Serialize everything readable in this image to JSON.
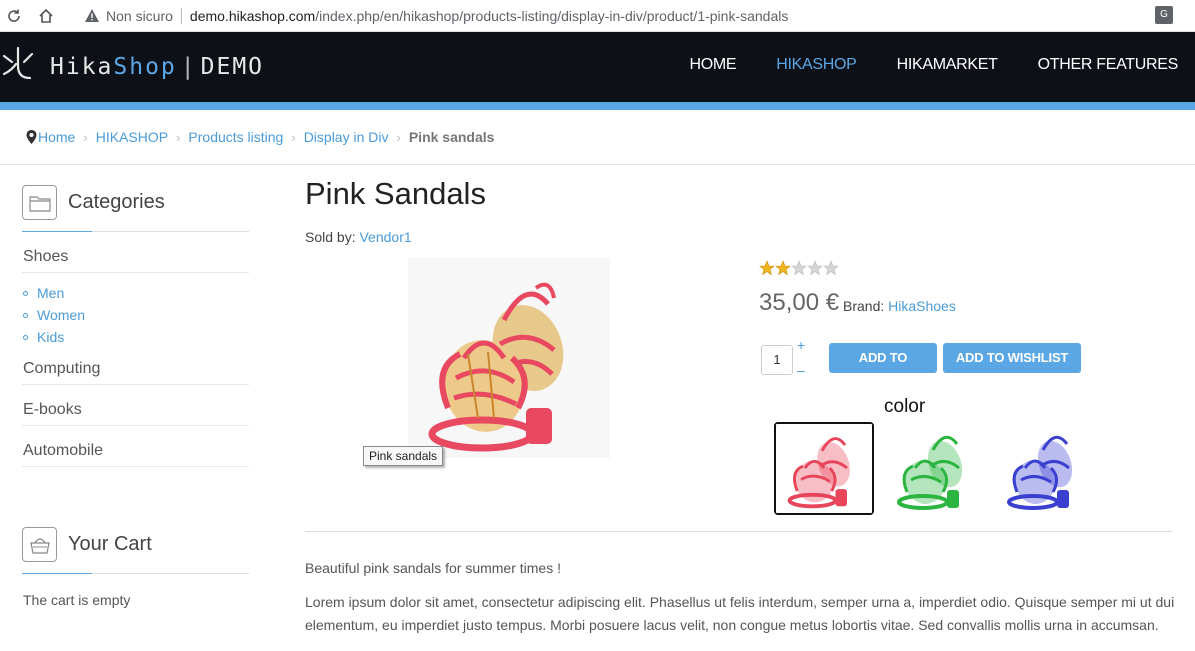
{
  "browser": {
    "security_label": "Non sicuro",
    "url_host": "demo.hikashop.com",
    "url_path": "/index.php/en/hikashop/products-listing/display-in-div/product/1-pink-sandals"
  },
  "header": {
    "logo_part1": "Hika",
    "logo_part2": "Shop",
    "logo_divider": "|",
    "logo_part3": "DEMO",
    "nav": [
      "HOME",
      "HIKASHOP",
      "HIKAMARKET",
      "OTHER FEATURES"
    ],
    "accent_color": "#5ba7e6"
  },
  "breadcrumb": {
    "items": [
      "Home",
      "HIKASHOP",
      "Products listing",
      "Display in Div"
    ],
    "current": "Pink sandals"
  },
  "sidebar": {
    "categories_title": "Categories",
    "categories": [
      "Shoes",
      "Computing",
      "E-books",
      "Automobile"
    ],
    "subcategories": [
      "Men",
      "Women",
      "Kids"
    ],
    "cart_title": "Your Cart",
    "cart_status": "The cart is empty"
  },
  "product": {
    "title": "Pink Sandals",
    "sold_by_label": "Sold by:",
    "vendor": "Vendor1",
    "image_tooltip": "Pink sandals",
    "rating": 2,
    "rating_max": 5,
    "price": "35,00 €",
    "brand_label": "Brand:",
    "brand": "HikaShoes",
    "quantity": "1",
    "qty_plus": "+",
    "qty_minus": "–",
    "add_to_cart": "ADD TO CART",
    "add_to_wishlist": "ADD TO WISHLIST",
    "color_label": "color",
    "colors": [
      {
        "name": "pink",
        "hex": "#e8445a"
      },
      {
        "name": "green",
        "hex": "#2bb540"
      },
      {
        "name": "blue",
        "hex": "#3a3fd0"
      }
    ],
    "short_description": "Beautiful pink sandals for summer times !",
    "long_description": "Lorem ipsum dolor sit amet, consectetur adipiscing elit. Phasellus ut felis interdum, semper urna a, imperdiet odio. Quisque semper mi ut dui elementum, eu imperdiet justo tempus. Morbi posuere lacus velit, non congue metus lobortis vitae. Sed convallis mollis urna in accumsan."
  }
}
